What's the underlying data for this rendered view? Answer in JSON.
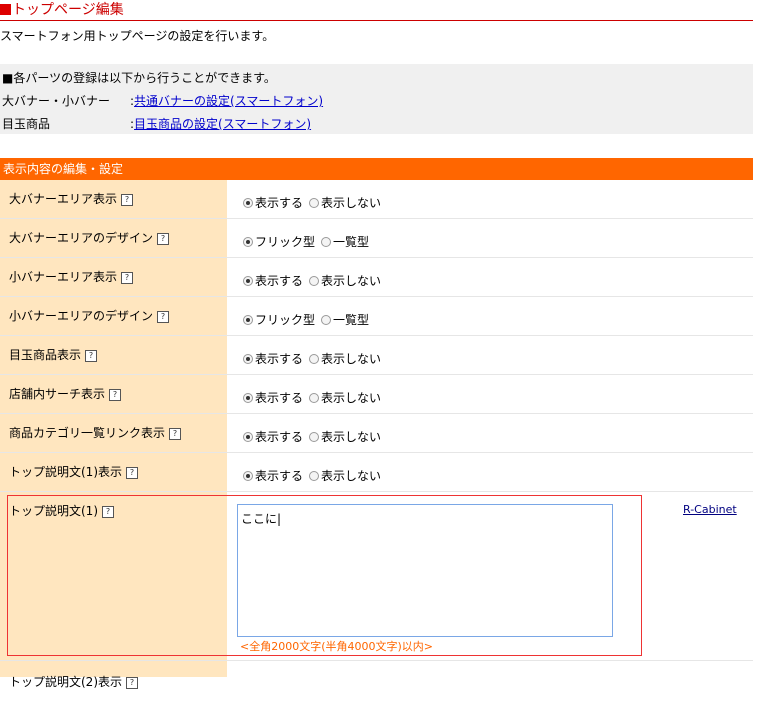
{
  "page_title": "トップページ編集",
  "description": "スマートフォン用トップページの設定を行います。",
  "parts_info": {
    "heading": "■各パーツの登録は以下から行うことができます。",
    "items": [
      {
        "label": "大バナー・小バナー",
        "link": "共通バナーの設定(スマートフォン)"
      },
      {
        "label": "目玉商品",
        "link": "目玉商品の設定(スマートフォン)"
      }
    ]
  },
  "section_title": "表示内容の編集・設定",
  "help_glyph": "?",
  "rows": [
    {
      "label": "大バナーエリア表示",
      "opt1": "表示する",
      "opt2": "表示しない"
    },
    {
      "label": "大バナーエリアのデザイン",
      "opt1": "フリック型",
      "opt2": "一覧型"
    },
    {
      "label": "小バナーエリア表示",
      "opt1": "表示する",
      "opt2": "表示しない"
    },
    {
      "label": "小バナーエリアのデザイン",
      "opt1": "フリック型",
      "opt2": "一覧型"
    },
    {
      "label": "目玉商品表示",
      "opt1": "表示する",
      "opt2": "表示しない"
    },
    {
      "label": "店舗内サーチ表示",
      "opt1": "表示する",
      "opt2": "表示しない"
    },
    {
      "label": "商品カテゴリ一覧リンク表示",
      "opt1": "表示する",
      "opt2": "表示しない"
    },
    {
      "label": "トップ説明文(1)表示",
      "opt1": "表示する",
      "opt2": "表示しない"
    }
  ],
  "text_row": {
    "label": "トップ説明文(1)",
    "value": "ここに|",
    "hint": "<全角2000文字(半角4000文字)以内>",
    "link": "R-Cabinet"
  },
  "last_row": {
    "label": "トップ説明文(2)表示"
  },
  "colors": {
    "accent": "#ff6600",
    "title_red": "#cc0000",
    "label_bg": "#ffe6bf"
  }
}
